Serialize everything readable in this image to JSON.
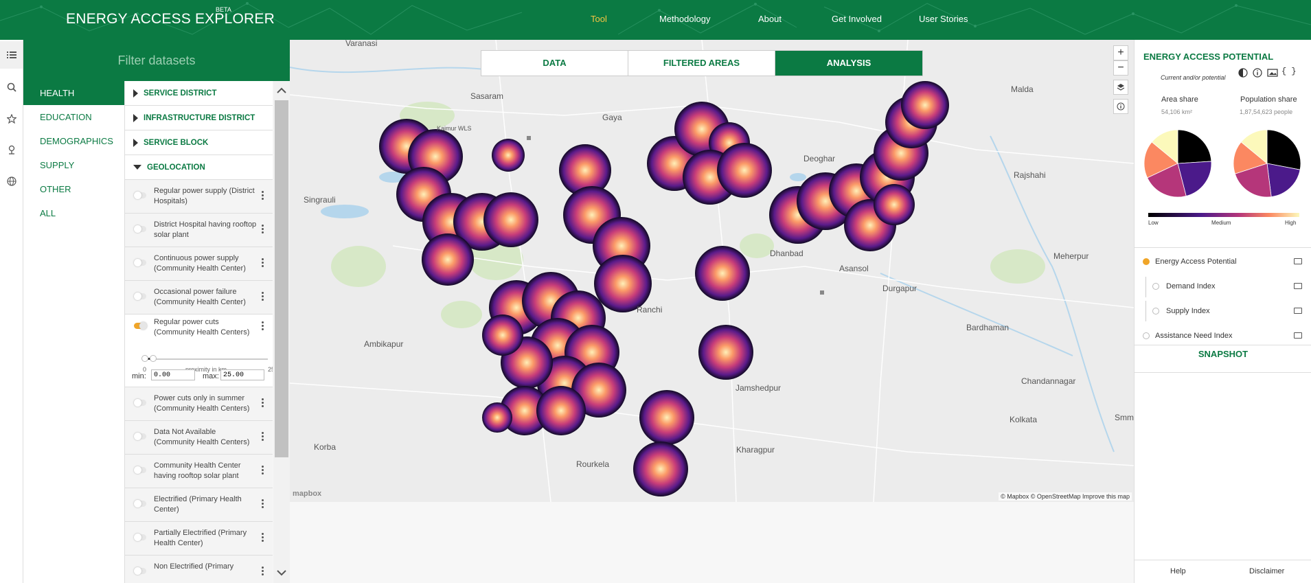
{
  "header": {
    "logo": "ENERGY ACCESS EXPLORER",
    "beta": "BETA",
    "nav": [
      {
        "label": "Tool",
        "active": true
      },
      {
        "label": "Methodology"
      },
      {
        "label": "About"
      },
      {
        "label": "Get Involved"
      },
      {
        "label": "User Stories"
      }
    ]
  },
  "rail": {
    "icons": [
      "list-icon",
      "search-icon",
      "star-icon",
      "location-pin-icon",
      "globe-icon"
    ]
  },
  "filter": {
    "placeholder": "Filter datasets"
  },
  "categories": [
    "HEALTH",
    "EDUCATION",
    "DEMOGRAPHICS",
    "SUPPLY",
    "OTHER",
    "ALL"
  ],
  "groups": {
    "service_district": "SERVICE DISTRICT",
    "infrastructure_district": "INFRASTRUCTURE DISTRICT",
    "service_block": "SERVICE BLOCK",
    "geolocation": "GEOLOCATION"
  },
  "datasets": [
    "Regular power supply (District Hospitals)",
    "District Hospital having rooftop solar plant",
    "Continuous power supply (Community Health Center)",
    "Occasional power failure (Community Health Center)"
  ],
  "expanded": {
    "label": "Regular power cuts (Community Health Centers)",
    "slider_label": "proximity in km",
    "range_min_label": "0",
    "range_max_label": "25",
    "min_label": "min:",
    "max_label": "max:",
    "min_value": "0.00",
    "max_value": "25.00"
  },
  "datasets_after": [
    "Power cuts only in summer (Community Health Centers)",
    "Data Not Available (Community Health Centers)",
    "Community Health Center having rooftop solar plant",
    "Electrified (Primary Health Center)",
    "Partially Electrified (Primary Health Center)",
    "Non Electrified (Primary"
  ],
  "map": {
    "tabs": [
      {
        "label": "DATA"
      },
      {
        "label": "FILTERED AREAS"
      },
      {
        "label": "ANALYSIS",
        "active": true
      }
    ],
    "places": [
      "Varanasi",
      "Sasaram",
      "Kaimur WLS",
      "Gaya",
      "Singrauli",
      "Malda",
      "Deoghar",
      "Rajshahi",
      "Dhanbad",
      "Asansol",
      "Durgapur",
      "Meherpur",
      "Ranchi",
      "Ambikapur",
      "Bardhaman",
      "Jamshedpur",
      "Chandannagar",
      "Korba",
      "Rourkela",
      "Kharagpur",
      "Kolkata",
      "Smm"
    ],
    "zoom_in": "+",
    "zoom_out": "−",
    "attribution": "© Mapbox © OpenStreetMap  Improve this map",
    "logo": "mapbox"
  },
  "right_panel": {
    "title": "ENERGY ACCESS POTENTIAL",
    "subtitle": "Current and/or potential",
    "area_share": {
      "label": "Area share",
      "value": "54,106 km²",
      "slices": [
        0.24,
        0.22,
        0.22,
        0.18,
        0.14
      ]
    },
    "population_share": {
      "label": "Population share",
      "value": "1,87,54,623 people",
      "slices": [
        0.28,
        0.2,
        0.22,
        0.16,
        0.14
      ]
    },
    "pie_colors": [
      "#000000",
      "#4b1a8a",
      "#b5367a",
      "#fb8861",
      "#fcf9bb"
    ],
    "legend": {
      "low": "Low",
      "medium": "Medium",
      "high": "High"
    },
    "indexes": [
      {
        "label": "Energy Access Potential",
        "active": true
      },
      {
        "label": "Demand Index"
      },
      {
        "label": "Supply Index"
      },
      {
        "label": "Assistance Need Index"
      }
    ],
    "snapshot": "SNAPSHOT",
    "help": "Help",
    "disclaimer": "Disclaimer"
  }
}
